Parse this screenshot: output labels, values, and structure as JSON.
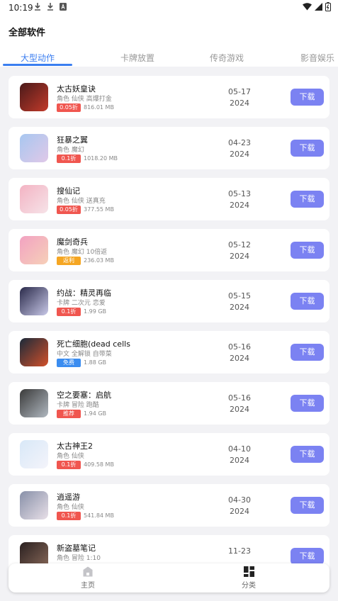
{
  "status": {
    "time": "10:19",
    "notif_icons": [
      "download-icon",
      "download-icon",
      "a-icon"
    ]
  },
  "page": {
    "title": "全部软件"
  },
  "tabs": [
    {
      "label": "大型动作",
      "active": true
    },
    {
      "label": "卡牌放置",
      "active": false
    },
    {
      "label": "传奇游戏",
      "active": false
    },
    {
      "label": "影音娱乐",
      "active": false
    }
  ],
  "apps": [
    {
      "name": "太古妖皇诀",
      "tags": "角色 仙侠 高爆打金",
      "badge": "0.05折",
      "badge_color": "red",
      "size": "816.01 MB",
      "date_md": "05-17",
      "date_y": "2024",
      "button": "下载",
      "icon_colors": [
        "#4a1a1a",
        "#c23a2a"
      ]
    },
    {
      "name": "狂暴之翼",
      "tags": "角色 魔幻",
      "badge": "0.1折",
      "badge_color": "red",
      "size": "1018.20 MB",
      "date_md": "04-23",
      "date_y": "2024",
      "button": "下载",
      "icon_colors": [
        "#a7c7f0",
        "#e0c8e8"
      ]
    },
    {
      "name": "搜仙记",
      "tags": "角色 仙侠 送真充",
      "badge": "0.05折",
      "badge_color": "red",
      "size": "377.55 MB",
      "date_md": "05-13",
      "date_y": "2024",
      "button": "下载",
      "icon_colors": [
        "#f3b3c3",
        "#f6e3e8"
      ]
    },
    {
      "name": "魔剑奇兵",
      "tags": "角色 魔幻 10倍返",
      "badge": "返利",
      "badge_color": "orange",
      "size": "236.03 MB",
      "date_md": "05-12",
      "date_y": "2024",
      "button": "下载",
      "icon_colors": [
        "#f2a2c2",
        "#f6d0b8"
      ]
    },
    {
      "name": "约战：精灵再临",
      "tags": "卡牌 二次元 恋爱",
      "badge": "0.1折",
      "badge_color": "red",
      "size": "1.99 GB",
      "date_md": "05-15",
      "date_y": "2024",
      "button": "下载",
      "icon_colors": [
        "#2a2a4a",
        "#c8c8e8"
      ]
    },
    {
      "name": "死亡细胞(dead cells",
      "tags": "中文 全解锁 自带菜",
      "badge": "免费",
      "badge_color": "blue",
      "size": "1.88 GB",
      "date_md": "05-16",
      "date_y": "2024",
      "button": "下载",
      "icon_colors": [
        "#1a2a3a",
        "#d2502a"
      ]
    },
    {
      "name": "空之要塞：启航",
      "tags": "卡牌 冒险 跑酷",
      "badge": "推荐",
      "badge_color": "red",
      "size": "1.94 GB",
      "date_md": "05-16",
      "date_y": "2024",
      "button": "下载",
      "icon_colors": [
        "#3a3a3a",
        "#b0b8c0"
      ]
    },
    {
      "name": "太古神王2",
      "tags": "角色 仙侠",
      "badge": "0.1折",
      "badge_color": "red",
      "size": "409.58 MB",
      "date_md": "04-10",
      "date_y": "2024",
      "button": "下载",
      "icon_colors": [
        "#d8e8f8",
        "#f4f4fa"
      ]
    },
    {
      "name": "逍遥游",
      "tags": "角色 仙侠",
      "badge": "0.1折",
      "badge_color": "red",
      "size": "541.84 MB",
      "date_md": "04-30",
      "date_y": "2024",
      "button": "下载",
      "icon_colors": [
        "#8890a8",
        "#e8e0e8"
      ]
    },
    {
      "name": "新盗墓笔记",
      "tags": "角色 冒险 1:10",
      "badge": "",
      "badge_color": "red",
      "size": "",
      "date_md": "11-23",
      "date_y": "",
      "button": "下载",
      "icon_colors": [
        "#2a2020",
        "#8a6a5a"
      ]
    }
  ],
  "nav": [
    {
      "label": "主页",
      "icon": "home-icon"
    },
    {
      "label": "分类",
      "icon": "category-icon"
    }
  ]
}
